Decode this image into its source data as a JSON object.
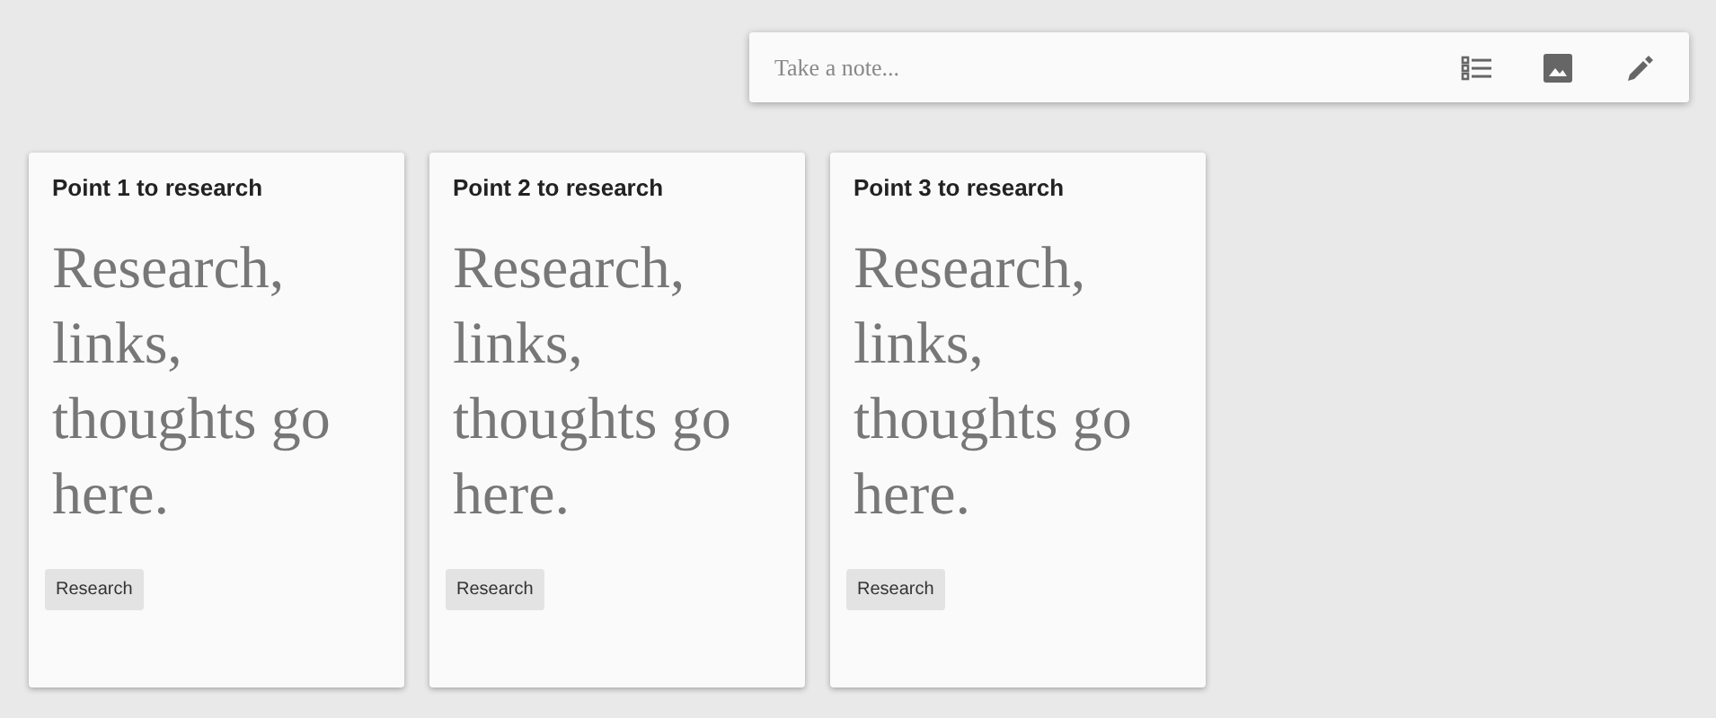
{
  "note_bar": {
    "placeholder": "Take a note..."
  },
  "notes": [
    {
      "title": "Point 1 to research",
      "body": "Research, links, thoughts go here.",
      "tag": "Research"
    },
    {
      "title": "Point 2 to research",
      "body": "Research, links, thoughts go here.",
      "tag": "Research"
    },
    {
      "title": "Point 3 to research",
      "body": "Research, links, thoughts go here.",
      "tag": "Research"
    }
  ]
}
